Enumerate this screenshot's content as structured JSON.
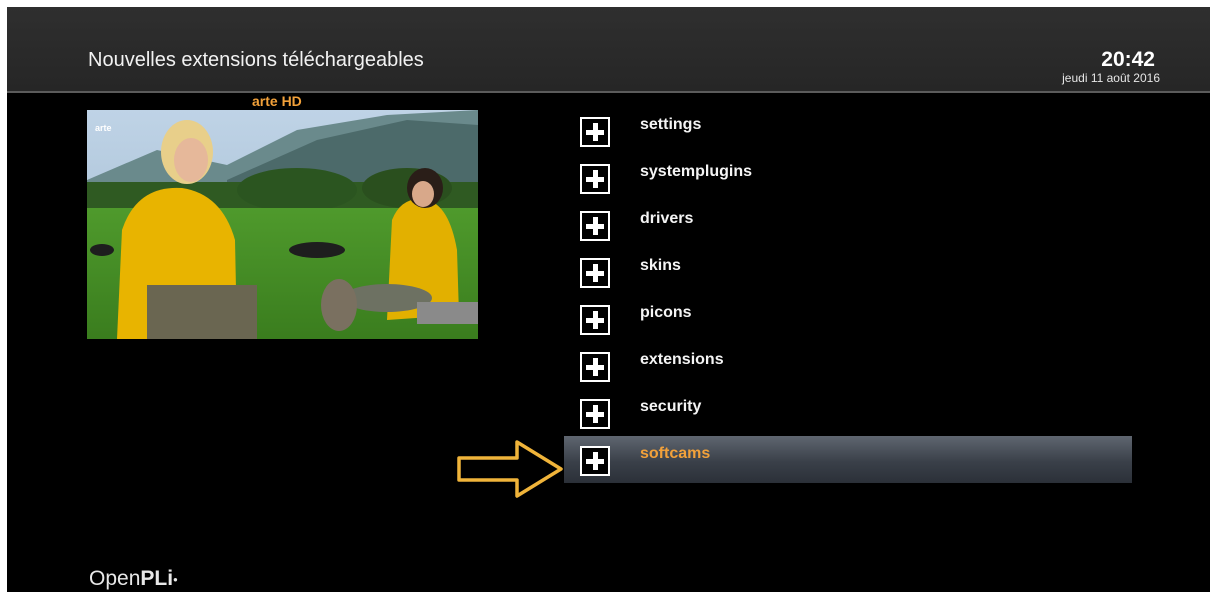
{
  "header": {
    "title": "Nouvelles extensions téléchargeables",
    "clock": "20:42",
    "date": "jeudi 11 août 2016"
  },
  "preview": {
    "channel_name": "arte HD",
    "watermark": "arte"
  },
  "categories": [
    {
      "label": "settings"
    },
    {
      "label": "systemplugins"
    },
    {
      "label": "drivers"
    },
    {
      "label": "skins"
    },
    {
      "label": "picons"
    },
    {
      "label": "extensions"
    },
    {
      "label": "security"
    },
    {
      "label": "softcams"
    }
  ],
  "selected_category": "softcams",
  "brand": {
    "prefix": "Open",
    "name": "PLi"
  },
  "colors": {
    "accent": "#f2a13a",
    "background": "#000000",
    "header": "#2a2a2a"
  }
}
